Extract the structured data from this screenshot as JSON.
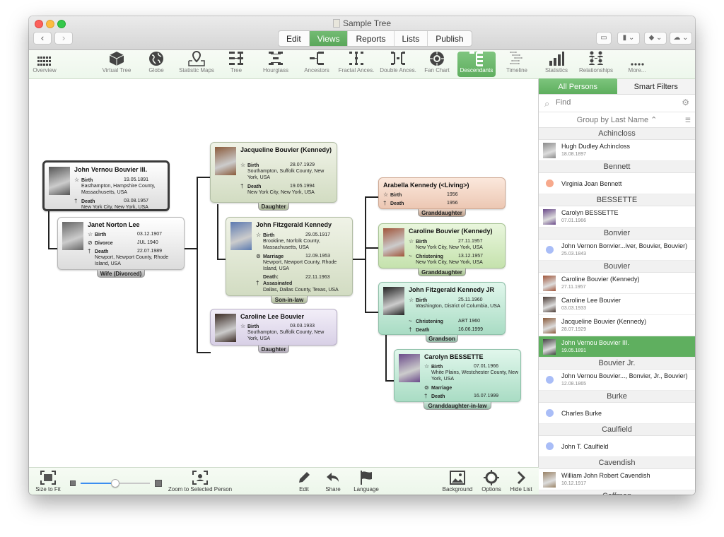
{
  "window": {
    "title": "Sample Tree",
    "nav": {
      "back": "‹",
      "forward": "›"
    },
    "main_tabs": [
      {
        "label": "Edit",
        "active": false
      },
      {
        "label": "Views",
        "active": true
      },
      {
        "label": "Reports",
        "active": false
      },
      {
        "label": "Lists",
        "active": false
      },
      {
        "label": "Publish",
        "active": false
      }
    ],
    "right_buttons": [
      {
        "name": "sidebar-toggle",
        "glyph": "▭"
      },
      {
        "name": "bookmarks",
        "glyph": "▮ ⌄"
      },
      {
        "name": "labels",
        "glyph": "◆ ⌄"
      },
      {
        "name": "cloud",
        "glyph": "☁ ⌄"
      }
    ]
  },
  "viewbar": {
    "items": [
      {
        "label": "Overview",
        "icon": "grid-icon",
        "active": false
      },
      {
        "label": "Virtual Tree",
        "icon": "cube-icon",
        "active": false
      },
      {
        "label": "Globe",
        "icon": "globe-icon",
        "active": false
      },
      {
        "label": "Statistic Maps",
        "icon": "map-pin-icon",
        "active": false
      },
      {
        "label": "Tree",
        "icon": "tree-chart-icon",
        "active": false
      },
      {
        "label": "Hourglass",
        "icon": "hourglass-chart-icon",
        "active": false
      },
      {
        "label": "Ancestors",
        "icon": "ancestors-chart-icon",
        "active": false
      },
      {
        "label": "Fractal Ances.",
        "icon": "fractal-chart-icon",
        "active": false
      },
      {
        "label": "Double Ances.",
        "icon": "double-ancestors-icon",
        "active": false
      },
      {
        "label": "Fan Chart",
        "icon": "fan-chart-icon",
        "active": false
      },
      {
        "label": "Descendants",
        "icon": "descendants-chart-icon",
        "active": true
      },
      {
        "label": "Timeline",
        "icon": "timeline-icon",
        "active": false
      },
      {
        "label": "Statistics",
        "icon": "bar-chart-icon",
        "active": false
      },
      {
        "label": "Relationships",
        "icon": "relationships-icon",
        "active": false
      },
      {
        "label": "More...",
        "icon": "more-icon",
        "active": false
      }
    ]
  },
  "tree": {
    "persons": [
      {
        "id": "jvb3",
        "name": "John Vernou Bouvier III.",
        "color": "gray",
        "selected": true,
        "relation": "",
        "events": [
          {
            "symbol": "☆",
            "label": "Birth",
            "date": "19.05.1891",
            "place": "Easthampton, Hampshire County, Massachusetts, USA"
          },
          {
            "symbol": "†",
            "label": "Death",
            "date": "03.08.1957",
            "place": "New York City, New York, USA"
          }
        ]
      },
      {
        "id": "jnl",
        "name": "Janet Norton Lee",
        "color": "gray",
        "selected": false,
        "relation": "Wife (Divorced)",
        "events": [
          {
            "symbol": "☆",
            "label": "Birth",
            "date": "03.12.1907",
            "place": ""
          },
          {
            "symbol": "⊘",
            "label": "Divorce",
            "date": "JUL 1940",
            "place": ""
          },
          {
            "symbol": "†",
            "label": "Death",
            "date": "22.07.1989",
            "place": "Newport, Newport County, Rhode Island, USA"
          }
        ]
      },
      {
        "id": "jbk",
        "name": "Jacqueline Bouvier (Kennedy)",
        "color": "green",
        "selected": false,
        "relation": "Daughter",
        "events": [
          {
            "symbol": "☆",
            "label": "Birth",
            "date": "28.07.1929",
            "place": "Southampton, Suffolk County, New York, USA"
          },
          {
            "symbol": "†",
            "label": "Death",
            "date": "19.05.1994",
            "place": "New York City, New York, USA"
          }
        ]
      },
      {
        "id": "jfk",
        "name": "John Fitzgerald Kennedy",
        "color": "green",
        "selected": false,
        "relation": "Son-in-law",
        "events": [
          {
            "symbol": "☆",
            "label": "Birth",
            "date": "29.05.1917",
            "place": "Brookline, Norfolk County, Massachusetts, USA"
          },
          {
            "symbol": "⊚",
            "label": "Marriage",
            "date": "12.09.1953",
            "place": "Newport, Newport County, Rhode Island, USA"
          },
          {
            "symbol": "†",
            "label": "Death: Assasinated",
            "date": "22.11.1963",
            "place": "Dallas, Dallas County, Texas, USA"
          }
        ]
      },
      {
        "id": "clb",
        "name": "Caroline Lee Bouvier",
        "color": "purple",
        "selected": false,
        "relation": "Daughter",
        "events": [
          {
            "symbol": "☆",
            "label": "Birth",
            "date": "03.03.1933",
            "place": "Southampton, Suffolk County, New York, USA"
          }
        ]
      },
      {
        "id": "ak",
        "name": "Arabella Kennedy (<Living>)",
        "color": "peach",
        "selected": false,
        "relation": "Granddaughter",
        "events": [
          {
            "symbol": "☆",
            "label": "Birth",
            "date": "1956",
            "place": ""
          },
          {
            "symbol": "†",
            "label": "Death",
            "date": "1956",
            "place": ""
          }
        ]
      },
      {
        "id": "cbk",
        "name": "Caroline Bouvier (Kennedy)",
        "color": "lgreen",
        "selected": false,
        "relation": "Granddaughter",
        "events": [
          {
            "symbol": "☆",
            "label": "Birth",
            "date": "27.11.1957",
            "place": "New York City, New York, USA"
          },
          {
            "symbol": "~",
            "label": "Christening",
            "date": "13.12.1957",
            "place": "New York City, New York, USA"
          }
        ]
      },
      {
        "id": "jfkjr",
        "name": "John Fitzgerald Kennedy JR",
        "color": "teal",
        "selected": false,
        "relation": "Grandson",
        "events": [
          {
            "symbol": "☆",
            "label": "Birth",
            "date": "25.11.1960",
            "place": "Washington, District of Columbia, USA"
          },
          {
            "symbol": "~",
            "label": "Christening",
            "date": "ABT 1960",
            "place": ""
          },
          {
            "symbol": "†",
            "label": "Death",
            "date": "16.06.1999",
            "place": ""
          }
        ]
      },
      {
        "id": "cb",
        "name": "Carolyn BESSETTE",
        "color": "teal",
        "selected": false,
        "relation": "Granddaughter-in-law",
        "events": [
          {
            "symbol": "☆",
            "label": "Birth",
            "date": "07.01.1966",
            "place": "White Plains, Westchester County, New York, USA"
          },
          {
            "symbol": "⊚",
            "label": "Marriage",
            "date": "",
            "place": ""
          },
          {
            "symbol": "†",
            "label": "Death",
            "date": "16.07.1999",
            "place": ""
          }
        ]
      }
    ]
  },
  "bottombar": {
    "size_to_fit": "Size to Fit",
    "zoom_slider_value": 0.5,
    "zoom_to_selected": "Zoom to Selected Person",
    "edit": "Edit",
    "share": "Share",
    "language": "Language",
    "background": "Background",
    "options": "Options",
    "hide_list": "Hide List"
  },
  "sidebar": {
    "tabs": [
      {
        "label": "All Persons",
        "active": true
      },
      {
        "label": "Smart Filters",
        "active": false
      }
    ],
    "search_placeholder": "Find",
    "group_by": "Group by Last Name ⌃",
    "groups": [
      {
        "header": "Achincloss",
        "rows": [
          {
            "name": "Hugh Dudley Achincloss",
            "date": "18.08.1897",
            "avatar": "photo",
            "tint": "#8a8a8a"
          }
        ]
      },
      {
        "header": "Bennett",
        "rows": [
          {
            "name": "Virginia Joan Bennett",
            "date": "",
            "avatar": "dot",
            "tint": "#f7a98c"
          }
        ]
      },
      {
        "header": "BESSETTE",
        "rows": [
          {
            "name": "Carolyn BESSETTE",
            "date": "07.01.1966",
            "avatar": "photo",
            "tint": "#6a4a8a"
          }
        ]
      },
      {
        "header": "Bonvier",
        "rows": [
          {
            "name": "John Vernon Bonvier...iver, Bouvier, Bouvier)",
            "date": "25.03.1843",
            "avatar": "dot",
            "tint": "#a9bdf7"
          }
        ]
      },
      {
        "header": "Bouvier",
        "rows": [
          {
            "name": "Caroline Bouvier (Kennedy)",
            "date": "27.11.1957",
            "avatar": "photo",
            "tint": "#a0553a"
          },
          {
            "name": "Caroline Lee Bouvier",
            "date": "03.03.1933",
            "avatar": "photo",
            "tint": "#4a3a34"
          },
          {
            "name": "Jacqueline Bouvier (Kennedy)",
            "date": "28.07.1929",
            "avatar": "photo",
            "tint": "#8a5a3a"
          },
          {
            "name": "John Vernou Bouvier III.",
            "date": "19.05.1891",
            "avatar": "photo",
            "tint": "#444444",
            "selected": true
          }
        ]
      },
      {
        "header": "Bouvier Jr.",
        "rows": [
          {
            "name": "John Vernou Bouvier..., Bonvier, Jr., Bouvier)",
            "date": "12.08.1865",
            "avatar": "dot",
            "tint": "#a9bdf7"
          }
        ]
      },
      {
        "header": "Burke",
        "rows": [
          {
            "name": "Charles Burke",
            "date": "",
            "avatar": "dot",
            "tint": "#a9bdf7"
          }
        ]
      },
      {
        "header": "Caulfield",
        "rows": [
          {
            "name": "John T. Caulfield",
            "date": "",
            "avatar": "dot",
            "tint": "#a9bdf7"
          }
        ]
      },
      {
        "header": "Cavendish",
        "rows": [
          {
            "name": "William John Robert Cavendish",
            "date": "10.12.1917",
            "avatar": "photo",
            "tint": "#9a8366"
          }
        ]
      },
      {
        "header": "Coffman",
        "rows": []
      }
    ]
  },
  "colors": {
    "accent_green": "#5faf5f",
    "selected_row": "#5faf5f",
    "slider_blue": "#3b8ef0"
  }
}
